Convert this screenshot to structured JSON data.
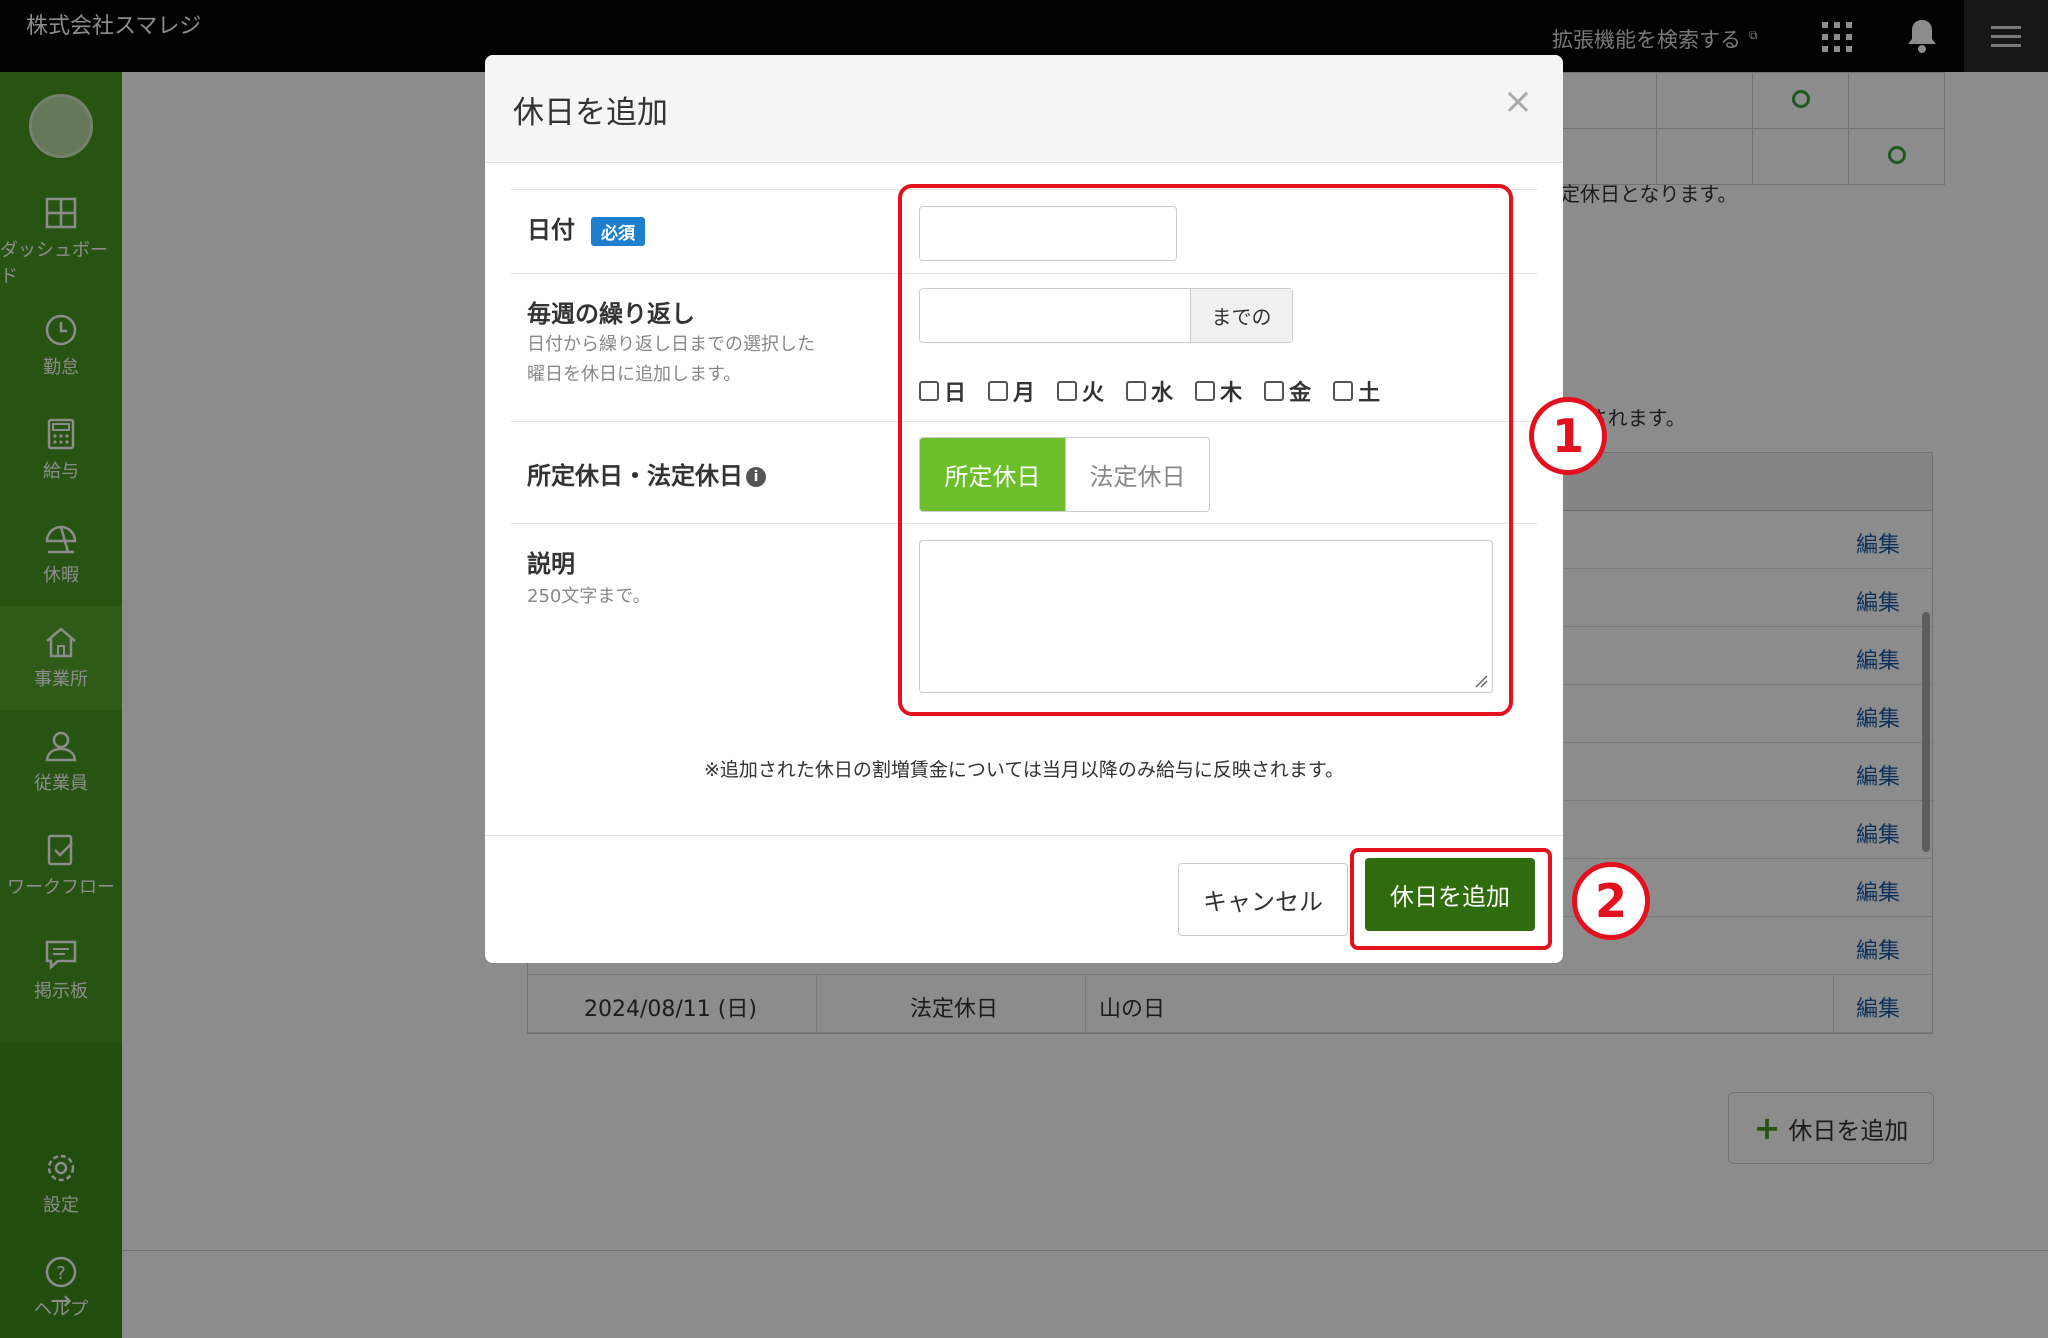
{
  "topbar": {
    "company": "株式会社スマレジ",
    "extension_search": "拡張機能を検索する",
    "external_mark": "⧉"
  },
  "sidebar": {
    "items": [
      {
        "label": "ダッシュボード",
        "icon": "dashboard-icon"
      },
      {
        "label": "勤怠",
        "icon": "clock-icon"
      },
      {
        "label": "給与",
        "icon": "calculator-icon"
      },
      {
        "label": "休暇",
        "icon": "umbrella-icon"
      },
      {
        "label": "事業所",
        "icon": "home-icon"
      },
      {
        "label": "従業員",
        "icon": "user-icon"
      },
      {
        "label": "ワークフロー",
        "icon": "workflow-icon"
      },
      {
        "label": "掲示板",
        "icon": "message-icon"
      },
      {
        "label": "設定",
        "icon": "gear-icon"
      },
      {
        "label": "ヘルプ",
        "icon": "help-icon"
      }
    ],
    "expand_arrow": "→"
  },
  "background": {
    "note_1": "定休日となります。",
    "note_2": "示)されます。",
    "edit_label": "編集",
    "last_row": {
      "date": "2024/08/11 (日)",
      "type": "法定休日",
      "name": "山の日"
    },
    "add_holiday": "休日を追加",
    "add_plus": "+"
  },
  "modal": {
    "title": "休日を追加",
    "close": "×",
    "date": {
      "label": "日付",
      "required": "必須",
      "value": ""
    },
    "repeat": {
      "label": "毎週の繰り返し",
      "help_line1": "日付から繰り返し日までの選択した",
      "help_line2": "曜日を休日に追加します。",
      "until_addon": "までの",
      "weekdays": [
        "日",
        "月",
        "火",
        "水",
        "木",
        "金",
        "土"
      ]
    },
    "holiday_type": {
      "label": "所定休日・法定休日",
      "info_icon": "i",
      "options": [
        "所定休日",
        "法定休日"
      ],
      "selected": "所定休日"
    },
    "description": {
      "label": "説明",
      "help": "250文字まで。",
      "value": ""
    },
    "note": "※追加された休日の割増賃金については当月以降のみ給与に反映されます。",
    "cancel": "キャンセル",
    "submit": "休日を追加"
  },
  "annotations": {
    "one": "1",
    "two": "2",
    "color": "#e5101e"
  }
}
